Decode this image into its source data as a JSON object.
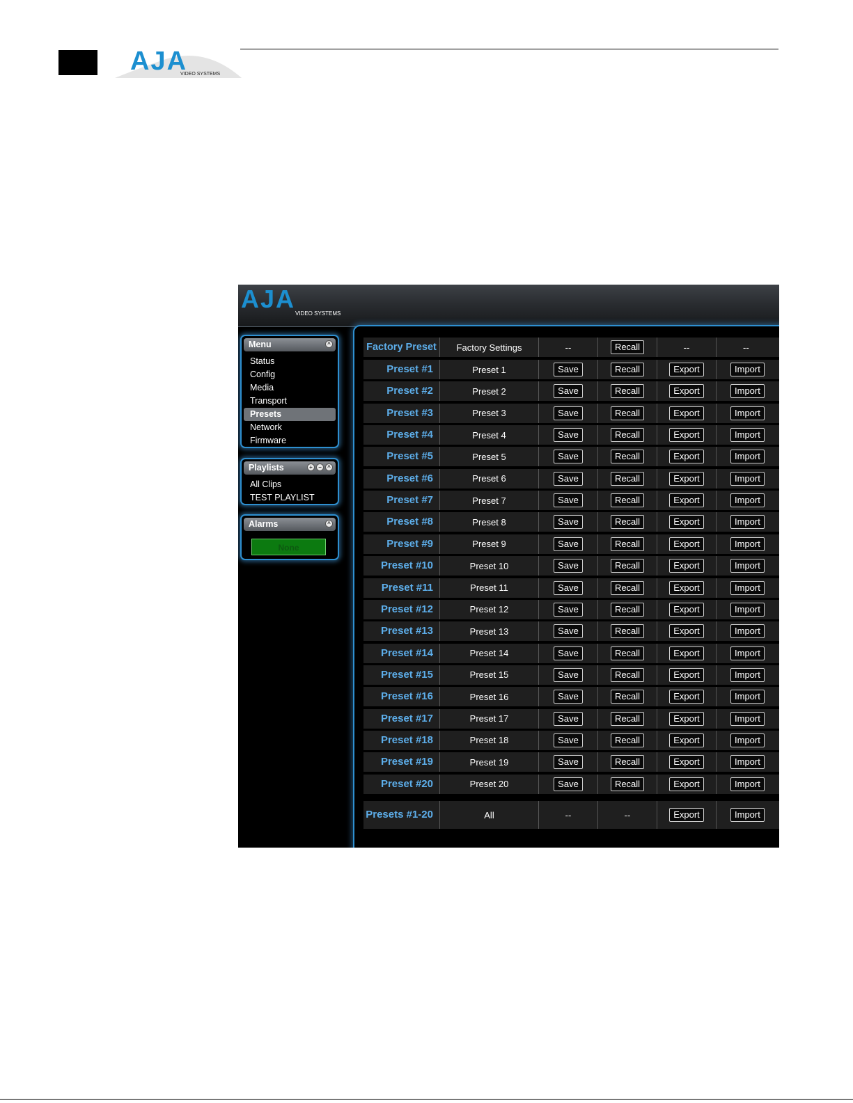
{
  "brand": {
    "logo_text": "AJA",
    "logo_subtext": "VIDEO SYSTEMS",
    "logo_color": "#1c8fd0"
  },
  "sidebar": {
    "menu": {
      "title": "Menu",
      "items": [
        "Status",
        "Config",
        "Media",
        "Transport",
        "Presets",
        "Network",
        "Firmware"
      ],
      "active": "Presets"
    },
    "playlists": {
      "title": "Playlists",
      "items": [
        "All Clips",
        "TEST PLAYLIST"
      ]
    },
    "alarms": {
      "title": "Alarms",
      "status": "None",
      "status_color": "#0c7a10"
    }
  },
  "presets": {
    "factory": {
      "label": "Factory Preset",
      "name": "Factory Settings",
      "save": "--",
      "recall": "Recall",
      "export": "--",
      "import": "--"
    },
    "rows": [
      {
        "label": "Preset #1",
        "name": "Preset 1"
      },
      {
        "label": "Preset #2",
        "name": "Preset 2"
      },
      {
        "label": "Preset #3",
        "name": "Preset 3"
      },
      {
        "label": "Preset #4",
        "name": "Preset 4"
      },
      {
        "label": "Preset #5",
        "name": "Preset 5"
      },
      {
        "label": "Preset #6",
        "name": "Preset 6"
      },
      {
        "label": "Preset #7",
        "name": "Preset 7"
      },
      {
        "label": "Preset #8",
        "name": "Preset 8"
      },
      {
        "label": "Preset #9",
        "name": "Preset 9"
      },
      {
        "label": "Preset #10",
        "name": "Preset 10"
      },
      {
        "label": "Preset #11",
        "name": "Preset 11"
      },
      {
        "label": "Preset #12",
        "name": "Preset 12"
      },
      {
        "label": "Preset #13",
        "name": "Preset 13"
      },
      {
        "label": "Preset #14",
        "name": "Preset 14"
      },
      {
        "label": "Preset #15",
        "name": "Preset 15"
      },
      {
        "label": "Preset #16",
        "name": "Preset 16"
      },
      {
        "label": "Preset #17",
        "name": "Preset 17"
      },
      {
        "label": "Preset #18",
        "name": "Preset 18"
      },
      {
        "label": "Preset #19",
        "name": "Preset 19"
      },
      {
        "label": "Preset #20",
        "name": "Preset 20"
      }
    ],
    "buttons": {
      "save": "Save",
      "recall": "Recall",
      "export": "Export",
      "import": "Import"
    },
    "all": {
      "label": "Presets #1-20",
      "name": "All",
      "save": "--",
      "recall": "--",
      "export": "Export",
      "import": "Import"
    },
    "label_color": "#5daeea"
  }
}
